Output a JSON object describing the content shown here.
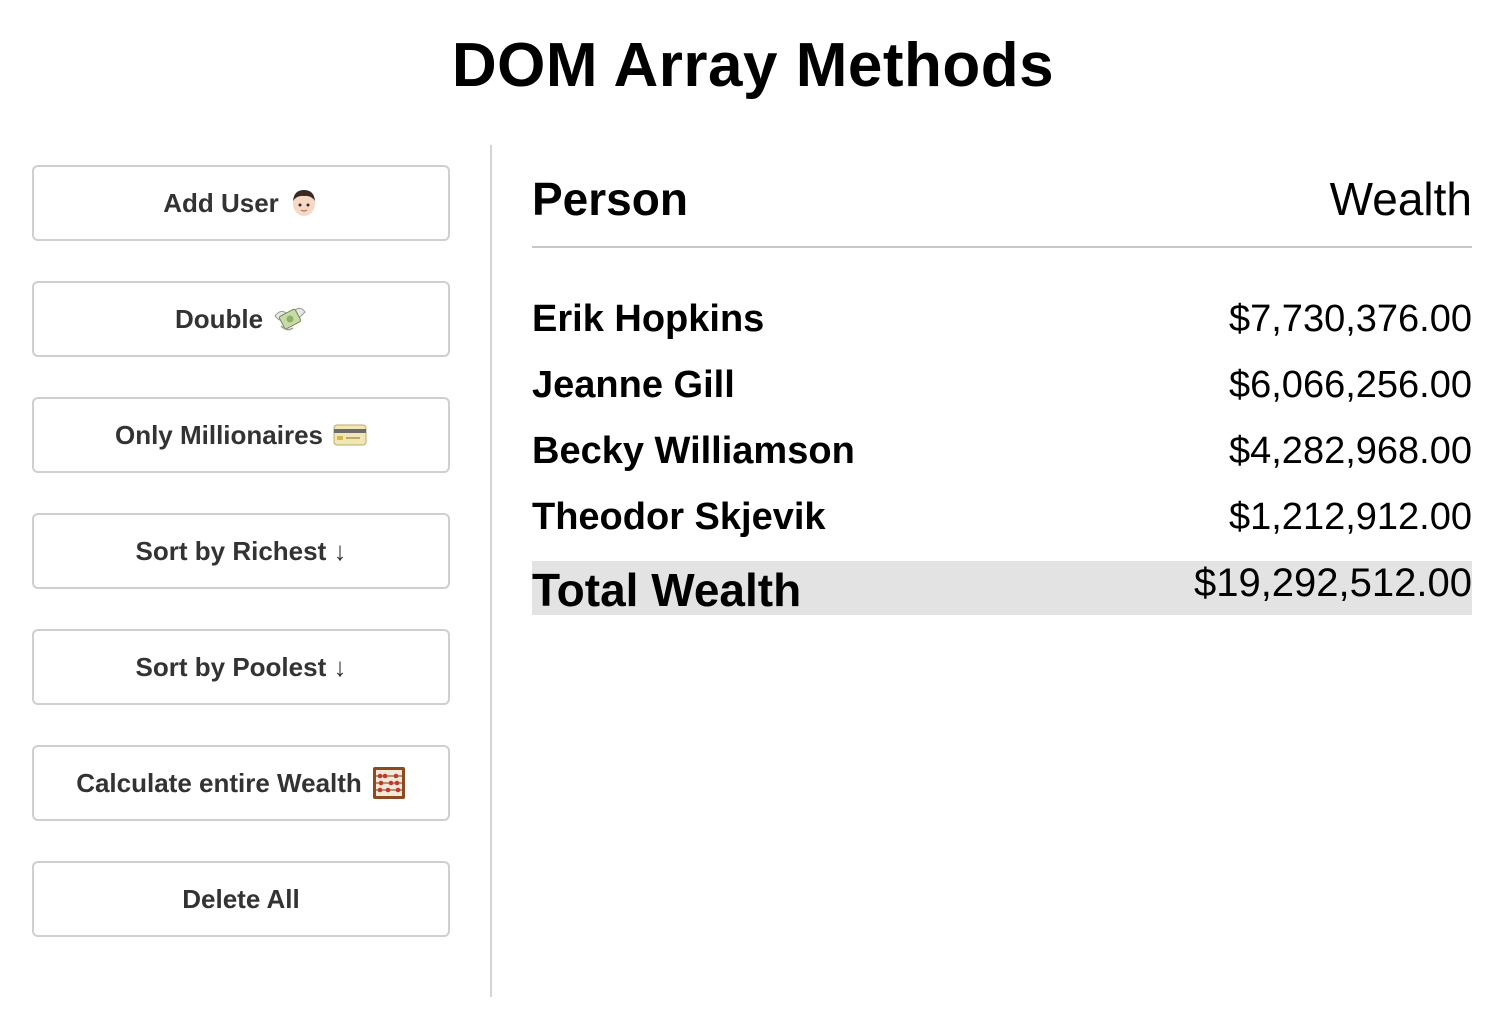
{
  "page": {
    "title": "DOM Array Methods"
  },
  "sidebar": {
    "buttons": [
      {
        "label": "Add User",
        "icon": "person-icon"
      },
      {
        "label": "Double",
        "icon": "money-with-wings-icon"
      },
      {
        "label": "Only Millionaires",
        "icon": "credit-card-icon"
      },
      {
        "label": "Sort by Richest ↓",
        "icon": ""
      },
      {
        "label": "Sort by Poolest ↓",
        "icon": ""
      },
      {
        "label": "Calculate entire Wealth",
        "icon": "abacus-icon"
      },
      {
        "label": "Delete All",
        "icon": ""
      }
    ]
  },
  "table": {
    "header": {
      "person": "Person",
      "wealth": "Wealth"
    },
    "rows": [
      {
        "name": "Erik Hopkins",
        "wealth": "$7,730,376.00"
      },
      {
        "name": "Jeanne Gill",
        "wealth": "$6,066,256.00"
      },
      {
        "name": "Becky Williamson",
        "wealth": "$4,282,968.00"
      },
      {
        "name": "Theodor Skjevik",
        "wealth": "$1,212,912.00"
      }
    ],
    "total": {
      "label": "Total Wealth",
      "amount": "$19,292,512.00"
    }
  },
  "colors": {
    "button_border": "#cfcfcf",
    "button_text": "#333333",
    "divider": "#d4d4d4",
    "total_row_bg": "#e3e3e3"
  }
}
